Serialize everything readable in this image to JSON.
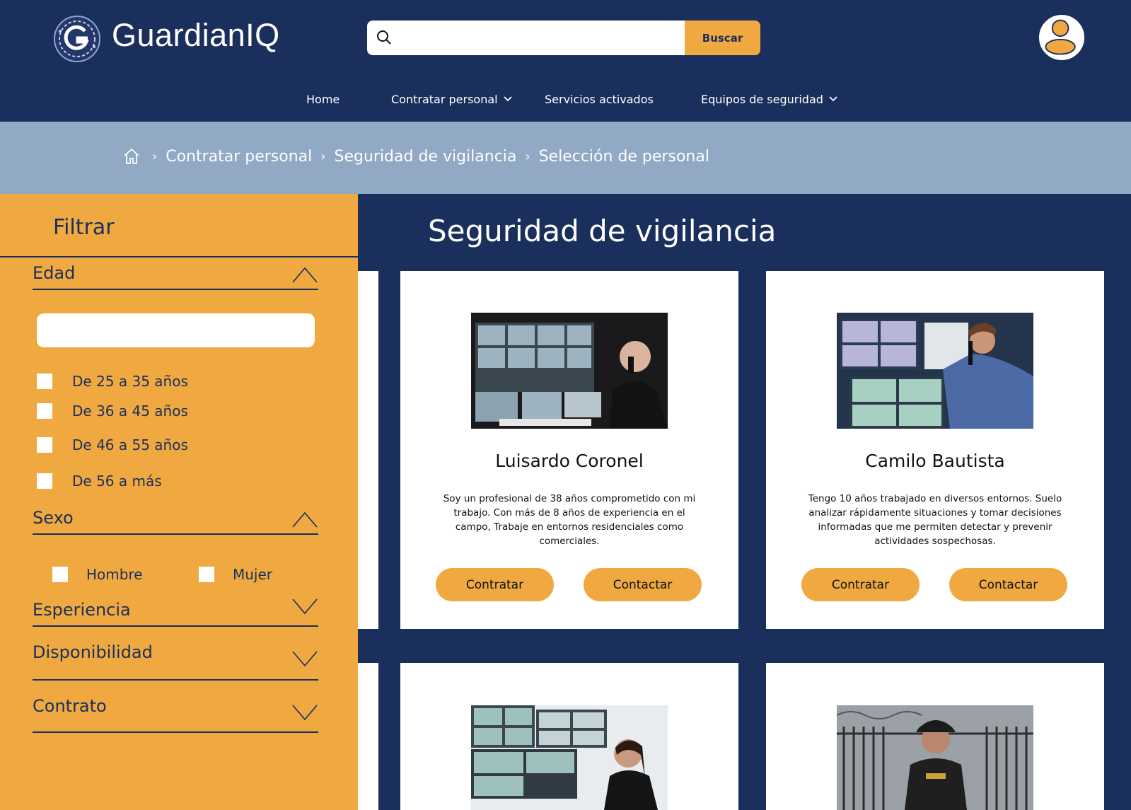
{
  "brand": {
    "name": "GuardianIQ"
  },
  "search": {
    "placeholder": "",
    "button_label": "Buscar"
  },
  "nav": {
    "items": [
      {
        "label": "Home",
        "has_dropdown": false
      },
      {
        "label": "Contratar personal",
        "has_dropdown": true
      },
      {
        "label": "Servicios activados",
        "has_dropdown": false
      },
      {
        "label": "Equipos de seguridad",
        "has_dropdown": true
      }
    ]
  },
  "breadcrumb": {
    "items": [
      "Contratar personal",
      "Seguridad de vigilancia",
      "Selección de personal"
    ],
    "separator": "›"
  },
  "sidebar": {
    "title": "Filtrar",
    "sections": [
      {
        "label": "Edad",
        "expanded": true
      },
      {
        "label": "Sexo",
        "expanded": true
      },
      {
        "label": "Esperiencia",
        "expanded": false
      },
      {
        "label": "Disponibilidad",
        "expanded": false
      },
      {
        "label": "Contrato",
        "expanded": false
      }
    ],
    "age_input_value": "",
    "age_options": [
      "De 25 a 35 años",
      "De 36 a 45 años",
      "De 46 a 55 años",
      "De 56 a más"
    ],
    "sex_options": [
      "Hombre",
      "Mujer"
    ]
  },
  "main": {
    "title": "Seguridad de vigilancia",
    "cards": [
      {
        "name": "Luisardo Coronel",
        "bio": "Soy un profesional de 38 años comprometido con mi trabajo. Con más de 8 años de experiencia en el campo, Trabaje en entornos residenciales como comerciales.",
        "hire_label": "Contratar",
        "contact_label": "Contactar"
      },
      {
        "name": "Camilo Bautista",
        "bio": "Tengo 10 años trabajado en diversos entornos. Suelo analizar rápidamente situaciones y tomar decisiones informadas que me permiten detectar y prevenir actividades sospechosas.",
        "hire_label": "Contratar",
        "contact_label": "Contactar"
      }
    ]
  },
  "colors": {
    "navy": "#1b2f5c",
    "accent": "#efa940",
    "breadcrumb_bg": "#91a9c4",
    "white": "#ffffff"
  }
}
